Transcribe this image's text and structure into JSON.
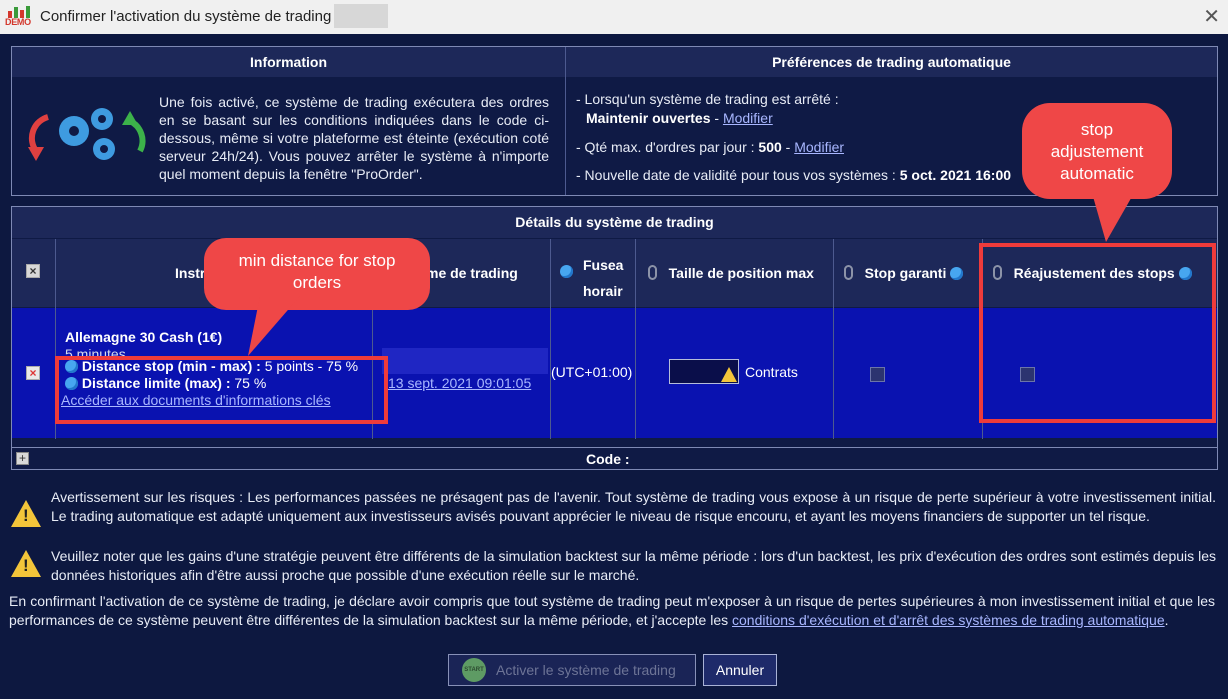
{
  "window": {
    "title": "Confirmer l'activation du système de trading -",
    "demo_label": "DEMO"
  },
  "information": {
    "header": "Information",
    "text": "Une fois activé, ce système de trading exécutera des ordres en se basant sur les conditions indiquées dans le code ci-dessous, même si votre plateforme est éteinte (exécution coté serveur 24h/24). Vous pouvez arrêter le système à n'importe quel moment depuis la fenêtre \"ProOrder\"."
  },
  "preferences": {
    "header": "Préférences de trading automatique",
    "line1": "- Lorsqu'un système de trading est arrêté :",
    "keep_open": "Maintenir ouvertes",
    "sep": " - ",
    "modify1": "Modifier",
    "max_orders_label": "- Qté max. d'ordres par jour : ",
    "max_orders_value": "500",
    "modify2": "Modifier",
    "validity_label": "- Nouvelle date de validité pour tous vos systèmes : ",
    "validity_value": "5 oct. 2021 16:00"
  },
  "details": {
    "header": "Détails du système de trading",
    "columns": {
      "instrument": "Instru",
      "system": "me de trading",
      "timezone_top": "Fusea",
      "timezone_bottom": "horair",
      "max_size": "Taille de position max",
      "guaranteed_stop": "Stop garanti",
      "stop_adjust": "Réajustement des stops"
    },
    "row": {
      "instrument": "Allemagne 30 Cash (1€)",
      "timeframe": "5 minutes",
      "stop_label": "Distance stop (min - max) :",
      "stop_value": " 5 points - 75 %",
      "limit_label": "Distance limite (max) :",
      "limit_value": " 75 %",
      "kid_link": "Accéder aux documents d'informations clés",
      "date": "13 sept. 2021 09:01:05",
      "timezone": "(UTC+01:00)",
      "contracts": "Contrats"
    },
    "code_label": "Code :"
  },
  "annotations": {
    "min_distance": "min distance for stop orders",
    "stop_adjust": "stop adjustement automatic"
  },
  "warnings": {
    "risk": "Avertissement sur les risques : Les performances passées ne présagent pas de l'avenir. Tout système de trading vous expose à un risque de perte supérieur à votre investissement initial. Le trading automatique est adapté uniquement aux investisseurs avisés pouvant apprécier le niveau de risque encouru, et ayant les moyens financiers de supporter un tel risque.",
    "backtest": "Veuillez noter que les gains d'une stratégie peuvent être différents de la simulation backtest sur la même période : lors d'un backtest, les prix d'exécution des ordres sont estimés depuis les données historiques afin d'être aussi proche que possible d'une exécution réelle sur le marché."
  },
  "confirmation": {
    "text": "En confirmant l'activation de ce système de trading, je déclare avoir compris que tout système de trading peut m'exposer à un risque de pertes supérieures à mon investissement initial et que les performances de ce système peuvent être différentes de la simulation backtest sur la même période, et j'accepte les ",
    "link": "conditions d'exécution et d'arrêt des systèmes de trading automatique",
    "end": "."
  },
  "buttons": {
    "start_icon": "START",
    "activate": "Activer le système de trading",
    "cancel": "Annuler"
  },
  "colors": {
    "background": "#0d1840",
    "row_blue": "#0a12b0",
    "annotation_red": "#ef4747"
  }
}
